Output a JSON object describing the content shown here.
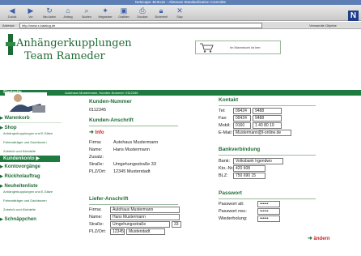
{
  "browser": {
    "title": "Netscape: BHKcat – Abeeuss Standardization Committe",
    "toolbar": [
      {
        "label": "Zurück",
        "icon": "back-arrow-icon"
      },
      {
        "label": "Vor",
        "icon": "forward-arrow-icon"
      },
      {
        "label": "Neu laden",
        "icon": "reload-icon"
      },
      {
        "label": "Anfang",
        "icon": "home-icon"
      },
      {
        "label": "Suchen",
        "icon": "search-icon"
      },
      {
        "label": "Wegweiser",
        "icon": "guide-icon"
      },
      {
        "label": "Grafiken",
        "icon": "images-icon"
      },
      {
        "label": "Drucken",
        "icon": "print-icon"
      },
      {
        "label": "Sicherheit",
        "icon": "security-icon"
      },
      {
        "label": "Stop",
        "icon": "stop-icon"
      }
    ],
    "address_label": "Adresse",
    "address_url": "http://www.x-katalog.de",
    "related": "Verwandte Objekte"
  },
  "site": {
    "logo_line1": "Anhängerkupplungen",
    "logo_line2": "Team Rameder",
    "cart_text": "Im Warenkorb ist leer",
    "nav_start": "Startseite",
    "nav_info": "Autohaus Mustermann, Kunden-Nummer: 0112345"
  },
  "sidebar": {
    "items": [
      {
        "label": "Warenkorb"
      },
      {
        "label": "Shop"
      },
      {
        "label": "Kontovorgänge"
      },
      {
        "label": "Rückholauftrag"
      },
      {
        "label": "Neuheitenliste"
      },
      {
        "label": "Schnäppchen"
      }
    ],
    "shop_subs": [
      "Anhängerkupplungen und E-Sätze",
      "Fahrradträger und Dachboxen",
      "Zubehör und Kleinteile"
    ],
    "active_item": "Kundenkonto",
    "news_subs": [
      "Anhängerkupplungen und E-Sätze",
      "Fahrradträger und Dachboxen",
      "Zubehör und Kleinteile"
    ]
  },
  "customer": {
    "number_title": "Kunden-Nummer",
    "number": "0112345",
    "address_title": "Kunden-Anschrift",
    "info_label": "Info",
    "fields": [
      {
        "label": "Firma:",
        "value": "Autohaus Mustermann"
      },
      {
        "label": "Name:",
        "value": "Hans Mustermann"
      },
      {
        "label": "Zusatz:",
        "value": ""
      },
      {
        "label": "Straße:",
        "value": "Umgehungsstraße 33"
      },
      {
        "label": "PLZ/Ort:",
        "value": "12345 Musterstadt"
      }
    ]
  },
  "delivery": {
    "title": "Liefer-Anschrift",
    "firma_label": "Firma:",
    "firma": "Autohaus Mustermann",
    "name_label": "Name:",
    "name": "Hans Mustermann",
    "street_label": "Straße:",
    "street": "Umgehungsstraße",
    "house_no": "33",
    "plz_label": "PLZ/Ort:",
    "plz": "12345",
    "city": "Musterstadt"
  },
  "contact": {
    "title": "Kontakt",
    "tel_label": "Tel:",
    "tel_prefix": "09424",
    "tel": "9488",
    "fax_label": "Fax:",
    "fax_prefix": "09424",
    "fax": "9488",
    "mobil_label": "Mobil:",
    "mobil_prefix": "0160",
    "mobil": "1 40 80 19",
    "email_label": "E-Mail:",
    "email": "Mustermann@t-online.de"
  },
  "bank": {
    "title": "Bankverbindung",
    "bank_label": "Bank:",
    "bank": "Volksbank Irgendwo",
    "kto_label": "Kto.-Nr.:",
    "kto": "420 608",
    "blz_label": "BLZ:",
    "blz": "750 690 15"
  },
  "password": {
    "title": "Passwort",
    "old_label": "Passwort alt:",
    "old": "••••••",
    "new_label": "Passwort neu:",
    "new": "••••••",
    "repeat_label": "Wiederholung:",
    "repeat": "••••••"
  },
  "actions": {
    "change_label": "ändern"
  },
  "colors": {
    "brand_green": "#1f7a3f",
    "link_red": "#cc2222",
    "chrome_blue": "#5d7fb6"
  }
}
